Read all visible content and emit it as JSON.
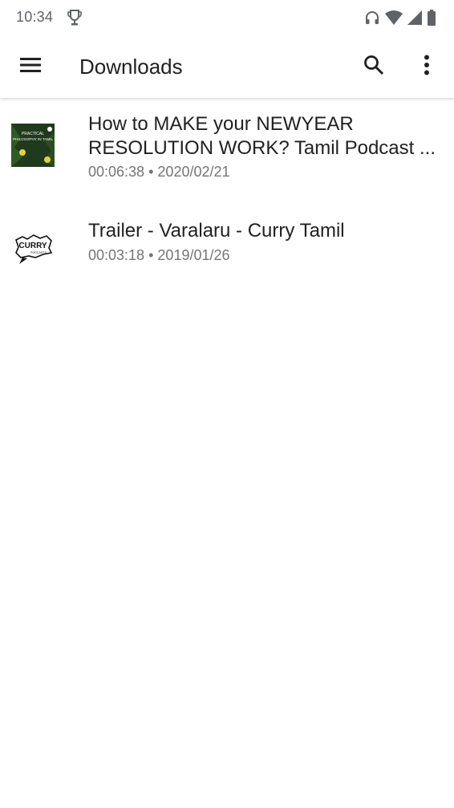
{
  "status_bar": {
    "time": "10:34"
  },
  "app_bar": {
    "title": "Downloads",
    "icons": [
      "menu-icon",
      "search-icon",
      "more-vert-icon"
    ]
  },
  "downloads": [
    {
      "title": "How to MAKE your NEWYEAR RESOLUTION WORK? Tamil Podcast ...",
      "duration": "00:06:38",
      "separator": "•",
      "date": "2020/02/21",
      "thumbnail_text": [
        "PRACTICAL",
        "PHILOSOPHY IN TAMIL"
      ]
    },
    {
      "title": "Trailer - Varalaru - Curry Tamil",
      "duration": "00:03:18",
      "separator": "•",
      "date": "2019/01/26",
      "thumbnail_text": [
        "CURRY",
        "PODCASTS"
      ]
    }
  ],
  "colors": {
    "text_primary": "#212121",
    "text_secondary": "#757575",
    "status_icons": "#5f6368",
    "background": "#ffffff"
  }
}
